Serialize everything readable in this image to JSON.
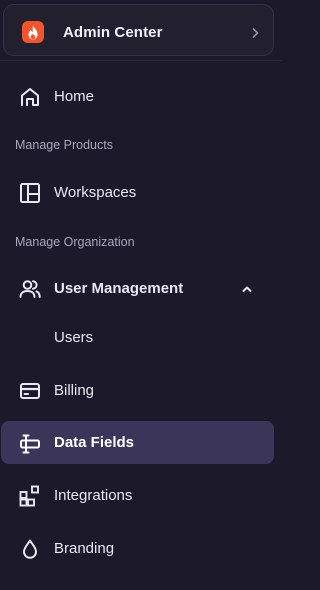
{
  "org_switcher": {
    "name": "Admin Center",
    "logo_icon": "flame-icon",
    "chevron_icon": "chevron-right-icon",
    "logo_color": "#f2542d"
  },
  "nav": {
    "home": {
      "label": "Home",
      "icon": "home-icon"
    },
    "section_products": "Manage Products",
    "workspaces": {
      "label": "Workspaces",
      "icon": "layout-icon"
    },
    "section_organization": "Manage Organization",
    "user_management": {
      "label": "User Management",
      "icon": "users-icon",
      "expanded": true
    },
    "users": {
      "label": "Users"
    },
    "billing": {
      "label": "Billing",
      "icon": "credit-card-icon"
    },
    "data_fields": {
      "label": "Data Fields",
      "icon": "data-field-icon",
      "active": true
    },
    "integrations": {
      "label": "Integrations",
      "icon": "integrations-icon"
    },
    "branding": {
      "label": "Branding",
      "icon": "droplet-icon"
    }
  },
  "colors": {
    "background": "#1c1a2a",
    "active_background": "#3b3559",
    "text": "#e9e7f1",
    "muted_text": "#a9a5bc"
  }
}
